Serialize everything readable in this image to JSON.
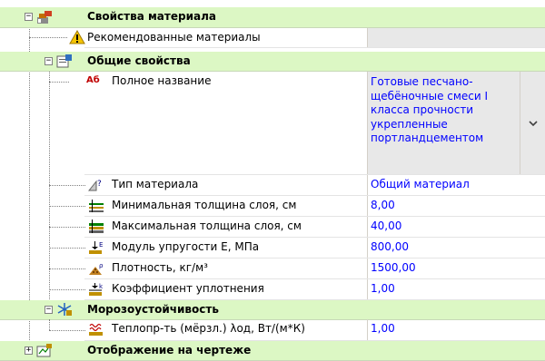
{
  "tree": {
    "root": {
      "label": "Свойства материала",
      "expanded": true
    },
    "recommended": {
      "label": "Рекомендованные материалы",
      "value": ""
    },
    "general": {
      "label": "Общие свойства",
      "expanded": true,
      "props": [
        {
          "name": "Полное название",
          "value": "Готовые песчано-щебёночные смеси I класса прочности укрепленные портландцементом",
          "icon": "abc-text-icon"
        },
        {
          "name": "Тип материала",
          "value": "Общий материал",
          "icon": "material-type-icon"
        },
        {
          "name": "Минимальная толщина слоя, см",
          "value": "8,00",
          "icon": "min-thickness-icon"
        },
        {
          "name": "Максимальная толщина слоя, см",
          "value": "40,00",
          "icon": "max-thickness-icon"
        },
        {
          "name": "Модуль упругости E, МПа",
          "value": "800,00",
          "icon": "elastic-modulus-icon"
        },
        {
          "name": "Плотность, кг/м³",
          "value": "1500,00",
          "icon": "density-icon"
        },
        {
          "name": "Коэффициент уплотнения",
          "value": "1,00",
          "icon": "compaction-icon"
        }
      ]
    },
    "frost": {
      "label": "Морозоустойчивость",
      "expanded": true,
      "props": [
        {
          "name": "Теплопр-ть (мёрзл.) λод, Вт/(м*К)",
          "value": "1,00",
          "icon": "thermal-icon"
        }
      ]
    },
    "drawing": {
      "label": "Отображение на чертеже",
      "expanded": false
    }
  },
  "expander_minus": "−",
  "expander_plus": "+",
  "abc_glyph": "Аб",
  "colors": {
    "category_bg": "#dcf7c4",
    "value_text": "#0000ff",
    "warning": "#f5c400"
  }
}
